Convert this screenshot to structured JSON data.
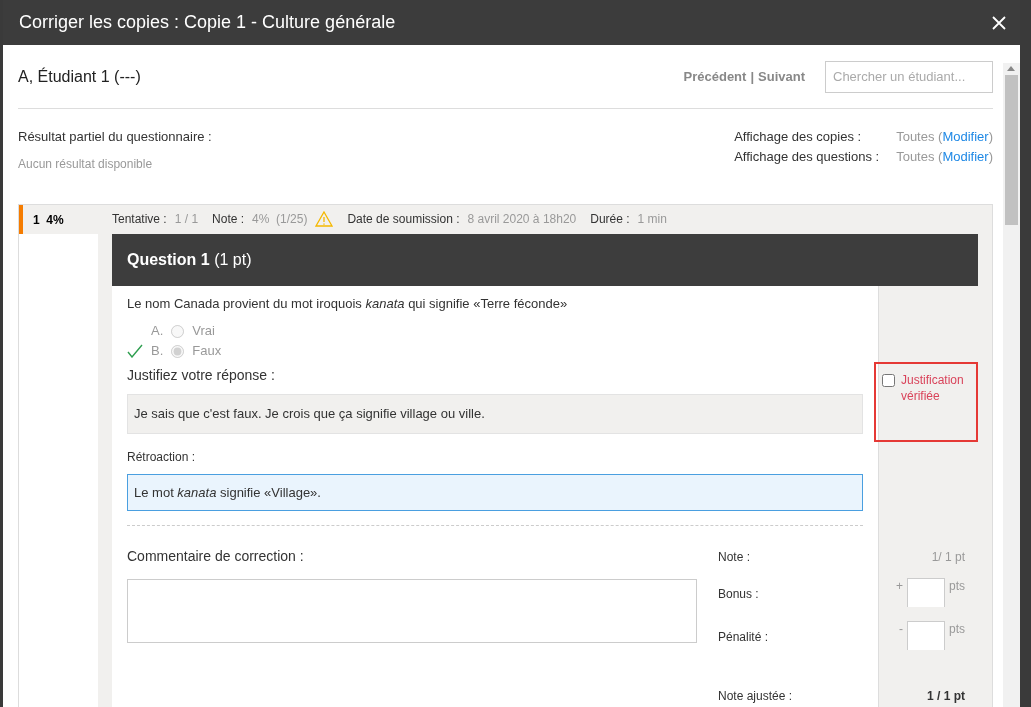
{
  "window": {
    "title": "Corriger les copies : Copie 1 - Culture générale"
  },
  "student": {
    "name": "A, Étudiant 1 (---)",
    "nav": [
      {
        "label": "Précédent"
      },
      {
        "label": "Suivant"
      }
    ],
    "separator": "|",
    "search": {
      "placeholder": "Chercher un étudiant..."
    }
  },
  "partial_result": {
    "label": "Résultat partiel du questionnaire :",
    "value": "Aucun résultat disponible"
  },
  "display_settings": [
    {
      "label": "Affichage des copies :",
      "value": "Toutes (",
      "link": "Modifier",
      "suffix": ")"
    },
    {
      "label": "Affichage des questions :",
      "value": "Toutes (",
      "link": "Modifier",
      "suffix": ")"
    }
  ],
  "copy_tabs": [
    {
      "number": "1",
      "score": "4%",
      "selected": true
    }
  ],
  "attempt": [
    {
      "label": "Tentative :",
      "value": "1 / 1",
      "warning": false
    },
    {
      "label": "Note :",
      "value": "4%  (1/25)",
      "warning": true
    },
    {
      "label": "Date de soumission :",
      "value": "8 avril 2020 à 18h20",
      "warning": false
    },
    {
      "label": "Durée :",
      "value": "1 min",
      "warning": false
    }
  ],
  "question": {
    "title": "Question 1",
    "points": "(1 pt)",
    "prompt": "Le nom Canada provient du mot iroquois *kanata* qui signifie «Terre féconde»",
    "choices": [
      {
        "letter": "A.",
        "label": "Vrai",
        "selected": false,
        "correct": false
      },
      {
        "letter": "B.",
        "label": "Faux",
        "selected": true,
        "correct": true
      }
    ],
    "justification_label": "Justifiez votre réponse :",
    "justification": "Je sais que c'est faux. Je crois que ça signifie village ou ville.",
    "justification_check": {
      "label": "Justification vérifiée",
      "checked": false,
      "highlighted": true
    },
    "feedback_label": "Rétroaction :",
    "feedback": "Le mot *kanata* signifie «Village».",
    "comment_label": "Commentaire de correction :",
    "grading": [
      {
        "kind": "text",
        "label": "Note :",
        "value": "1/ 1 pt"
      },
      {
        "kind": "input",
        "label": "Bonus :",
        "sign": "+",
        "unit": "pts"
      },
      {
        "kind": "input",
        "label": "Pénalité :",
        "sign": "-",
        "unit": "pts"
      },
      {
        "kind": "total",
        "label": "Note ajustée :",
        "value": "1 / 1 pt"
      }
    ]
  }
}
